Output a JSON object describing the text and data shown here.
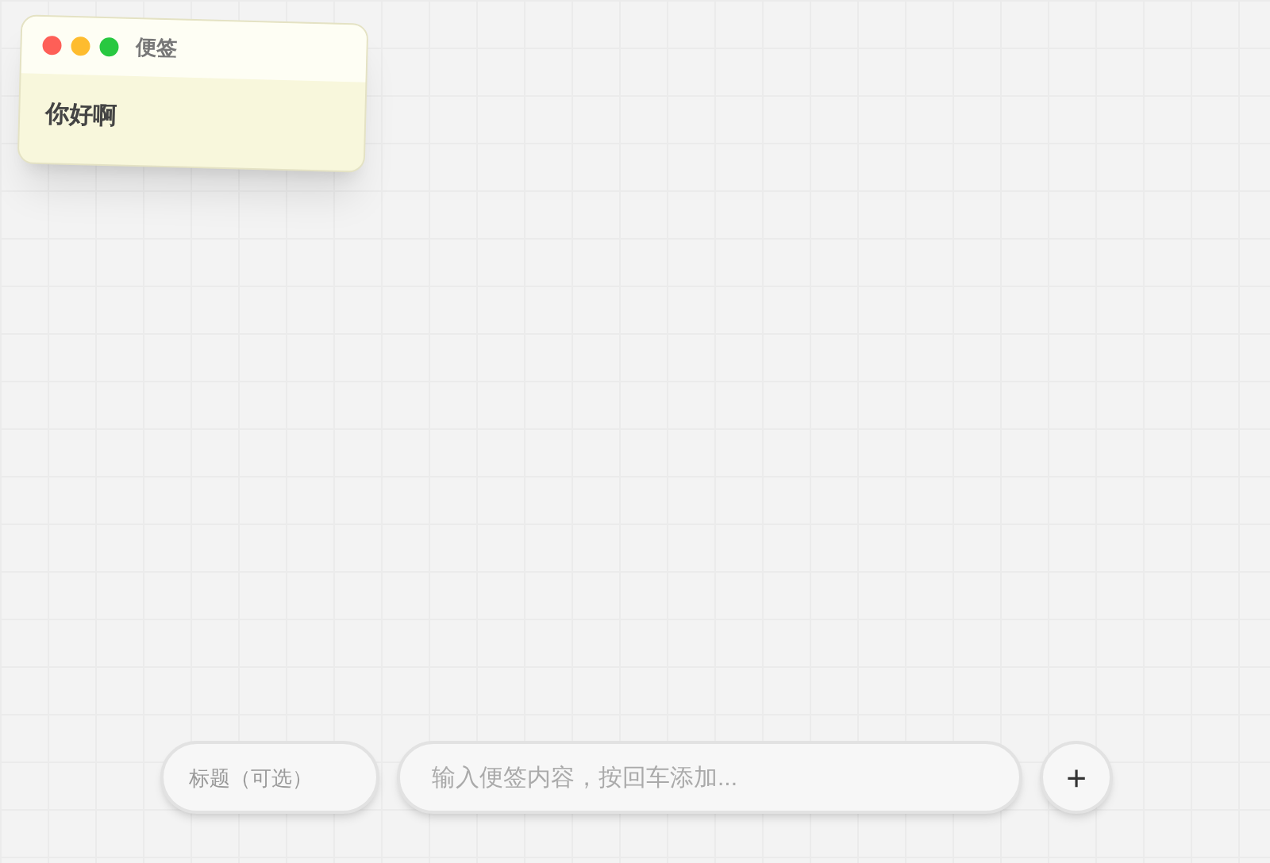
{
  "notes": [
    {
      "title": "便签",
      "content": "你好啊"
    }
  ],
  "composer": {
    "title_placeholder": "标题（可选）",
    "content_placeholder": "输入便签内容，按回车添加...",
    "add_button": "+"
  }
}
